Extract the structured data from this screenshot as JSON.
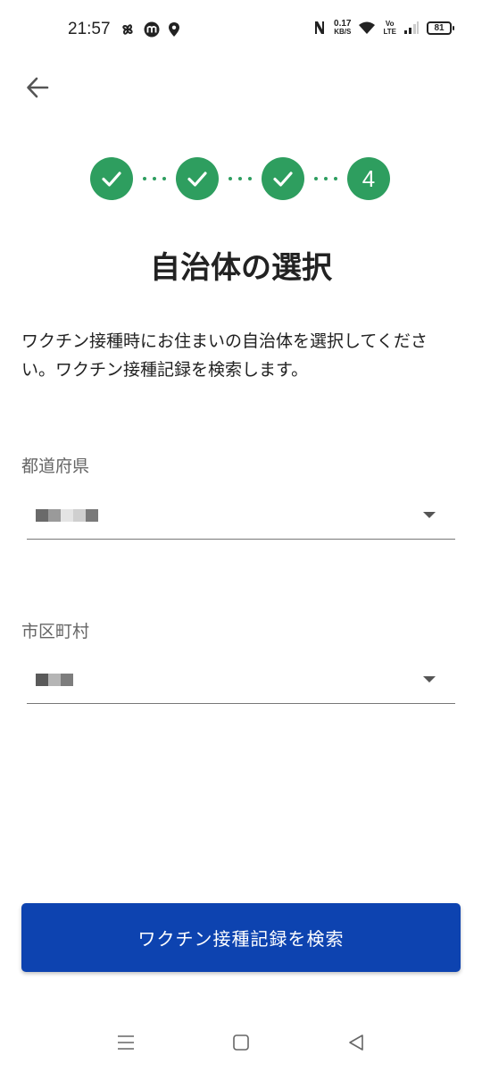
{
  "status_bar": {
    "time": "21:57",
    "net_speed_value": "0.17",
    "net_speed_unit": "KB/S",
    "volte_top": "Vo",
    "volte_bottom": "LTE",
    "battery": "81"
  },
  "colors": {
    "accent_green": "#2e9e5f",
    "button_blue": "#0d43b0"
  },
  "stepper": {
    "steps": [
      "check",
      "check",
      "check",
      "4"
    ],
    "current_step": "4"
  },
  "page": {
    "title": "自治体の選択",
    "description": "ワクチン接種時にお住まいの自治体を選択してください。ワクチン接種記録を検索します。"
  },
  "form": {
    "prefecture_label": "都道府県",
    "municipality_label": "市区町村"
  },
  "search_button_label": "ワクチン接種記録を検索",
  "nav": {
    "icons": [
      "menu-icon",
      "home-icon",
      "back-triangle-icon"
    ]
  }
}
